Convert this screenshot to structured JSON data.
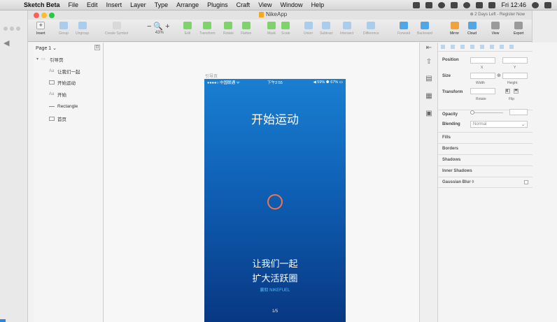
{
  "menubar": {
    "app_name": "Sketch Beta",
    "items": [
      "File",
      "Edit",
      "Insert",
      "Layer",
      "Type",
      "Arrange",
      "Plugins",
      "Craft",
      "View",
      "Window",
      "Help"
    ],
    "clock": "Fri 12:46"
  },
  "window": {
    "doc_title": "NikeApp",
    "trial_notice": "⊕ 2 Days Left - Register Now"
  },
  "toolbar": {
    "insert": "Insert",
    "group": "Group",
    "ungroup": "Ungroup",
    "create_symbol": "Create Symbol",
    "zoom_value": "43%",
    "edit": "Edit",
    "transform": "Transform",
    "rotate": "Rotate",
    "flatten": "Flatten",
    "mask": "Mask",
    "scale": "Scale",
    "union": "Union",
    "subtract": "Subtract",
    "intersect": "Intersect",
    "difference": "Difference",
    "forward": "Forward",
    "backward": "Backward",
    "mirror": "Mirror",
    "cloud": "Cloud",
    "view": "View",
    "export": "Export"
  },
  "layers": {
    "page": "Page 1",
    "artboard": "引导页",
    "items": [
      {
        "icon": "Aa",
        "name": "让我们一起"
      },
      {
        "icon": "img",
        "name": "开始运动"
      },
      {
        "icon": "Aa",
        "name": "开始"
      },
      {
        "icon": "line",
        "name": "Rectangle"
      },
      {
        "icon": "img",
        "name": "首页"
      }
    ]
  },
  "canvas": {
    "artboard_label": "引导页",
    "status_carrier": "●●●●○ 中国联通 ᯤ",
    "status_time": "下午2:55",
    "status_battery": "◀ 59% ⚉ 67% ▭",
    "title": "开始运动",
    "tagline_1": "让我们一起",
    "tagline_2": "扩大活跃圈",
    "fuel_text": "赢取 NIKEFUEL",
    "pager": "1/5"
  },
  "inspector": {
    "position": "Position",
    "x": "X",
    "y": "Y",
    "size": "Size",
    "width": "Width",
    "height": "Height",
    "transform": "Transform",
    "rotate": "Rotate",
    "flip": "Flip",
    "opacity": "Opacity",
    "blending": "Blending",
    "blending_value": "Normal",
    "fills": "Fills",
    "borders": "Borders",
    "shadows": "Shadows",
    "inner_shadows": "Inner Shadows",
    "gaussian_blur": "Gaussian Blur ◊"
  },
  "colors": {
    "accent_blue": "#1a7fd1",
    "ring": "#f0764a",
    "fuel": "#5db9f5"
  }
}
